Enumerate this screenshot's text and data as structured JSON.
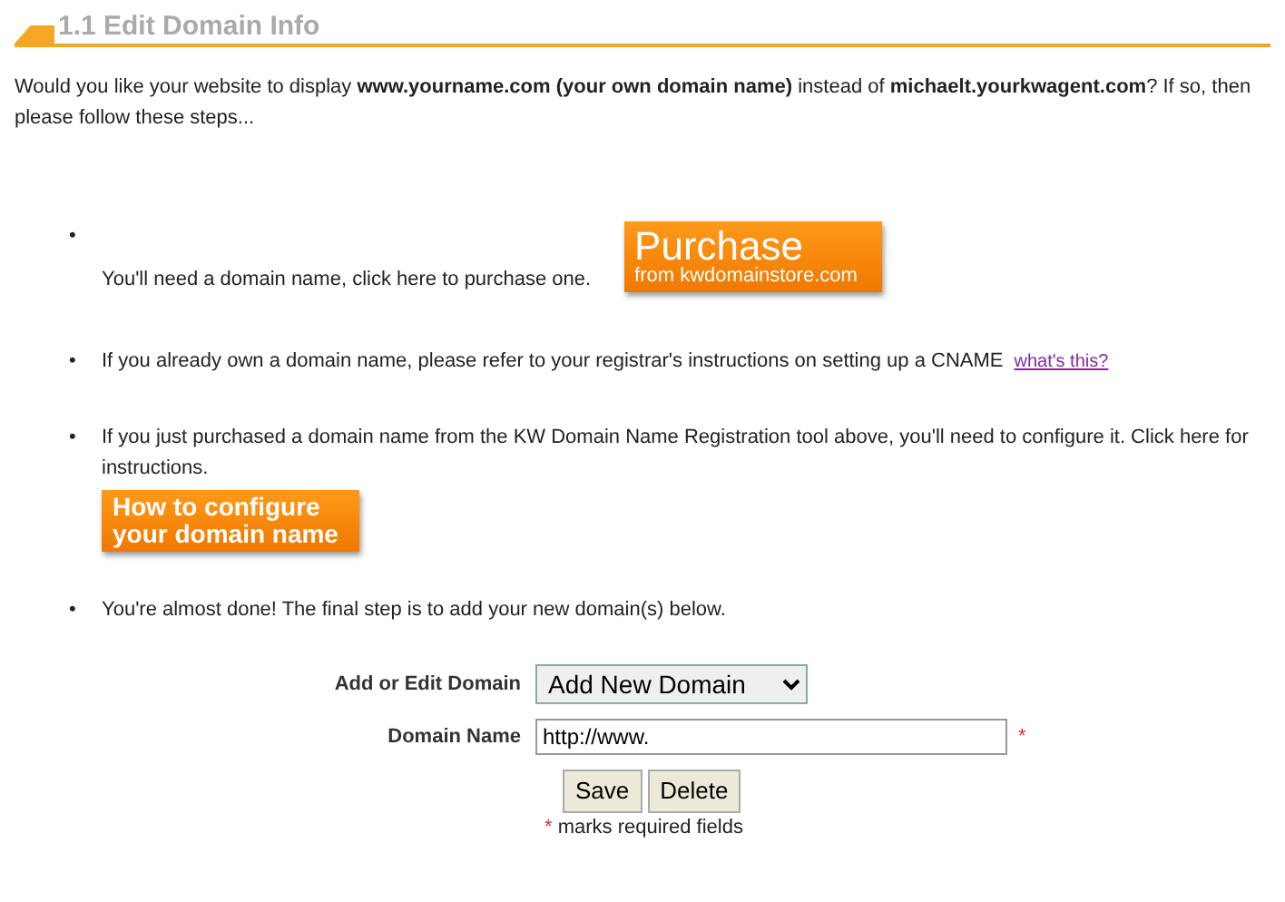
{
  "header": {
    "title": "1.1 Edit Domain Info"
  },
  "intro": "Would you like your website to display **www.yourname.com (your own domain name)** instead of **michaelt.yourkwagent.com**? If so, then please follow these steps...",
  "steps": [
    {
      "kind": "button_after",
      "bullet": "•",
      "text": "You'll need a domain name, click here to purchase one.",
      "button": {
        "title": "Purchase",
        "subtitle": "from kwdomainstore.com"
      }
    },
    {
      "kind": "link",
      "bullet": "•",
      "text": "If you already own a domain name, please refer to your registrar's instructions on setting up a CNAME",
      "link": "what's this?"
    },
    {
      "kind": "button_below",
      "bullet": "•",
      "text": "If you just purchased a domain name from the KW Domain Name Registration tool above, you'll need to configure it. Click here for instructions.",
      "button": {
        "title": "How to configure your domain name"
      }
    },
    {
      "kind": "plain",
      "bullet": "•",
      "text": "You're almost done! The final step is to add your new domain(s) below."
    }
  ],
  "form": {
    "fields": [
      {
        "kind": "select",
        "label": "Add or Edit Domain",
        "value": "Add New Domain"
      },
      {
        "kind": "text",
        "label": "Domain Name",
        "value": "http://www.",
        "required_mark": "*"
      }
    ],
    "buttons": [
      "Save",
      "Delete"
    ],
    "required_note": {
      "mark": "*",
      "text": "marks required fields"
    }
  }
}
